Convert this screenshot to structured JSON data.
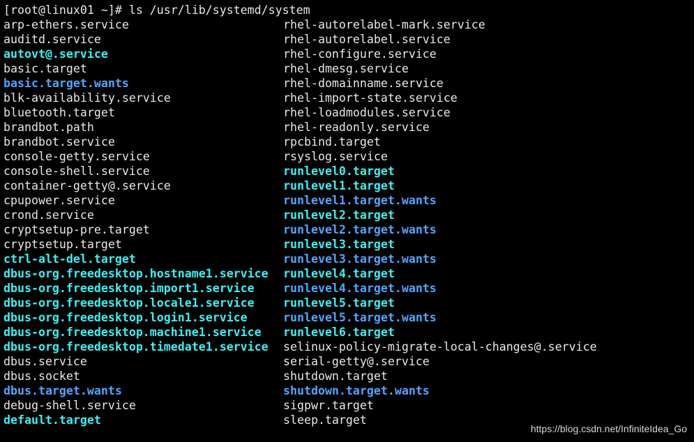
{
  "terminal": {
    "prompt": "[root@linux01 ~]#",
    "command": " ls /usr/lib/systemd/system",
    "colors": {
      "background": "#000000",
      "plain": "#e8e8e8",
      "link": "#38f2f2",
      "dir": "#4fa6ff"
    },
    "left_column": [
      {
        "name": "arp-ethers.service",
        "kind": "plain"
      },
      {
        "name": "auditd.service",
        "kind": "plain"
      },
      {
        "name": "autovt@.service",
        "kind": "link"
      },
      {
        "name": "basic.target",
        "kind": "plain"
      },
      {
        "name": "basic.target.wants",
        "kind": "dir"
      },
      {
        "name": "blk-availability.service",
        "kind": "plain"
      },
      {
        "name": "bluetooth.target",
        "kind": "plain"
      },
      {
        "name": "brandbot.path",
        "kind": "plain"
      },
      {
        "name": "brandbot.service",
        "kind": "plain"
      },
      {
        "name": "console-getty.service",
        "kind": "plain"
      },
      {
        "name": "console-shell.service",
        "kind": "plain"
      },
      {
        "name": "container-getty@.service",
        "kind": "plain"
      },
      {
        "name": "cpupower.service",
        "kind": "plain"
      },
      {
        "name": "crond.service",
        "kind": "plain"
      },
      {
        "name": "cryptsetup-pre.target",
        "kind": "plain"
      },
      {
        "name": "cryptsetup.target",
        "kind": "plain"
      },
      {
        "name": "ctrl-alt-del.target",
        "kind": "link"
      },
      {
        "name": "dbus-org.freedesktop.hostname1.service",
        "kind": "link"
      },
      {
        "name": "dbus-org.freedesktop.import1.service",
        "kind": "link"
      },
      {
        "name": "dbus-org.freedesktop.locale1.service",
        "kind": "link"
      },
      {
        "name": "dbus-org.freedesktop.login1.service",
        "kind": "link"
      },
      {
        "name": "dbus-org.freedesktop.machine1.service",
        "kind": "link"
      },
      {
        "name": "dbus-org.freedesktop.timedate1.service",
        "kind": "link"
      },
      {
        "name": "dbus.service",
        "kind": "plain"
      },
      {
        "name": "dbus.socket",
        "kind": "plain"
      },
      {
        "name": "dbus.target.wants",
        "kind": "dir"
      },
      {
        "name": "debug-shell.service",
        "kind": "plain"
      },
      {
        "name": "default.target",
        "kind": "link"
      }
    ],
    "right_column": [
      {
        "name": "rhel-autorelabel-mark.service",
        "kind": "plain"
      },
      {
        "name": "rhel-autorelabel.service",
        "kind": "plain"
      },
      {
        "name": "rhel-configure.service",
        "kind": "plain"
      },
      {
        "name": "rhel-dmesg.service",
        "kind": "plain"
      },
      {
        "name": "rhel-domainname.service",
        "kind": "plain"
      },
      {
        "name": "rhel-import-state.service",
        "kind": "plain"
      },
      {
        "name": "rhel-loadmodules.service",
        "kind": "plain"
      },
      {
        "name": "rhel-readonly.service",
        "kind": "plain"
      },
      {
        "name": "rpcbind.target",
        "kind": "plain"
      },
      {
        "name": "rsyslog.service",
        "kind": "plain"
      },
      {
        "name": "runlevel0.target",
        "kind": "link"
      },
      {
        "name": "runlevel1.target",
        "kind": "link"
      },
      {
        "name": "runlevel1.target.wants",
        "kind": "dir"
      },
      {
        "name": "runlevel2.target",
        "kind": "link"
      },
      {
        "name": "runlevel2.target.wants",
        "kind": "dir"
      },
      {
        "name": "runlevel3.target",
        "kind": "link"
      },
      {
        "name": "runlevel3.target.wants",
        "kind": "dir"
      },
      {
        "name": "runlevel4.target",
        "kind": "link"
      },
      {
        "name": "runlevel4.target.wants",
        "kind": "dir"
      },
      {
        "name": "runlevel5.target",
        "kind": "link"
      },
      {
        "name": "runlevel5.target.wants",
        "kind": "dir"
      },
      {
        "name": "runlevel6.target",
        "kind": "link"
      },
      {
        "name": "selinux-policy-migrate-local-changes@.service",
        "kind": "plain"
      },
      {
        "name": "serial-getty@.service",
        "kind": "plain"
      },
      {
        "name": "shutdown.target",
        "kind": "plain"
      },
      {
        "name": "shutdown.target.wants",
        "kind": "dir"
      },
      {
        "name": "sigpwr.target",
        "kind": "plain"
      },
      {
        "name": "sleep.target",
        "kind": "plain"
      }
    ]
  },
  "watermark": "https://blog.csdn.net/InfiniteIdea_Go"
}
